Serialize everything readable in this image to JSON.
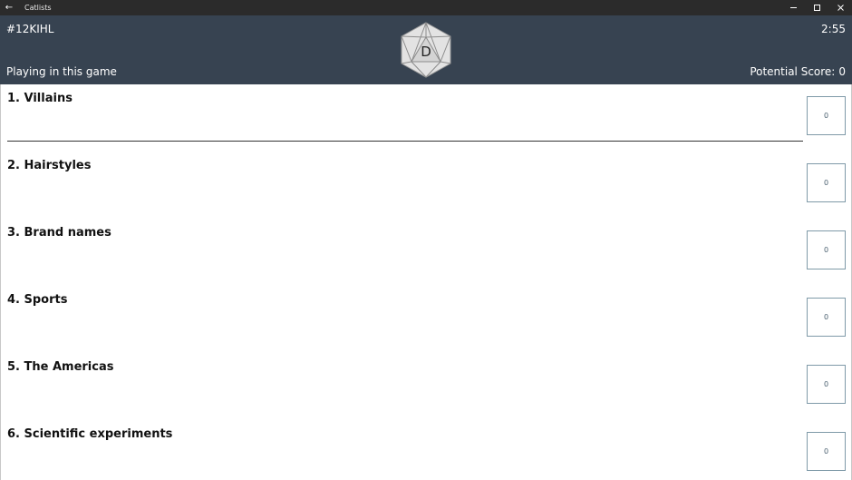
{
  "window": {
    "title": "Catlists",
    "back_glyph": "←",
    "controls": [
      "minimize-icon",
      "maximize-icon",
      "close-icon"
    ]
  },
  "header": {
    "game_code": "#12KIHL",
    "timer": "2:55",
    "playing_label": "Playing in this game",
    "score_label": "Potential Score:",
    "score_value": "0",
    "die_letter": "D",
    "background_color": "#374351"
  },
  "categories": [
    {
      "label": "1. Villains",
      "answer": "",
      "score": "0"
    },
    {
      "label": "2. Hairstyles",
      "answer": "",
      "score": "0"
    },
    {
      "label": "3. Brand names",
      "answer": "",
      "score": "0"
    },
    {
      "label": "4. Sports",
      "answer": "",
      "score": "0"
    },
    {
      "label": "5. The Americas",
      "answer": "",
      "score": "0"
    },
    {
      "label": "6. Scientific experiments",
      "answer": "",
      "score": "0"
    }
  ]
}
